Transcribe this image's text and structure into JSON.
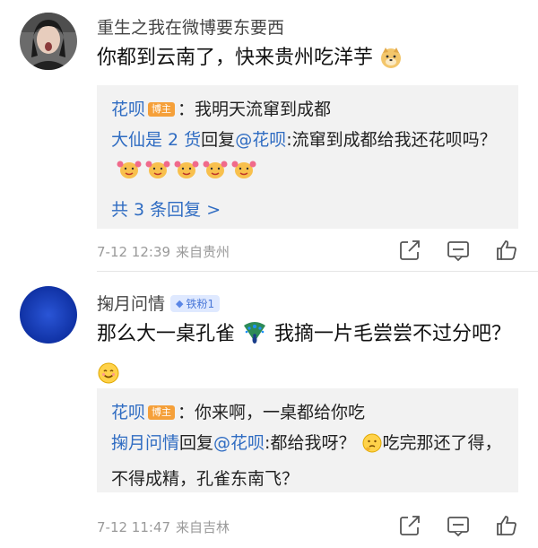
{
  "comments": [
    {
      "user": "重生之我在微博要东要西",
      "text": "你都到云南了，快来贵州吃洋芋",
      "replies": [
        {
          "author": "花呗",
          "badge": "博主",
          "text": "：我明天流窜到成都"
        },
        {
          "author": "大仙是 2 货",
          "action": "回复",
          "target": "@花呗",
          "text": ":流窜到成都给我还花呗吗？"
        }
      ],
      "more_replies": "共 3 条回复 >",
      "time": "7-12 12:39",
      "location": "来自贵州"
    },
    {
      "user": "掬月问情",
      "fan_badge": "铁粉1",
      "text_a": "那么大一桌孔雀",
      "text_b": "我摘一片毛尝尝不过分吧？",
      "replies": [
        {
          "author": "花呗",
          "badge": "博主",
          "text": "：你来啊，一桌都给你吃"
        },
        {
          "author": "掬月问情",
          "action": "回复",
          "target": "@花呗",
          "text_a": ":都给我呀？",
          "text_b": "吃完那还了得，不得成精，孔雀东南飞？"
        }
      ],
      "time": "7-12 11:47",
      "location": "来自吉林"
    }
  ],
  "icons": {
    "share": "share-icon",
    "comment": "comment-icon",
    "like": "like-icon"
  }
}
